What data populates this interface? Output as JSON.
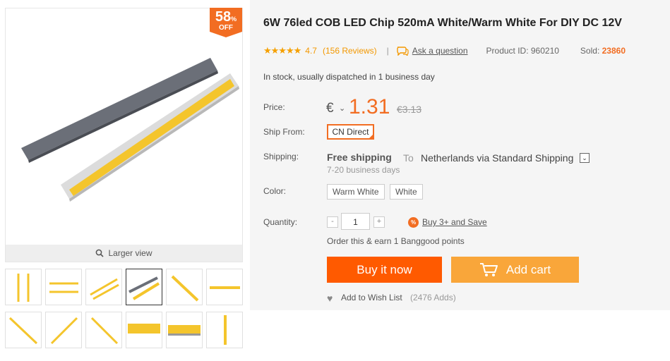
{
  "product": {
    "title": "6W 76led COB LED Chip 520mA White/Warm White For DIY DC 12V",
    "rating": "4.7",
    "reviews": "(156 Reviews)",
    "ask": "Ask a question",
    "product_id": "Product ID: 960210",
    "sold_label": "Sold:",
    "sold_value": "23860",
    "stock": "In stock, usually dispatched in 1 business day"
  },
  "gallery": {
    "discount_pct": "58",
    "discount_sign": "%",
    "discount_off": "OFF",
    "larger_view": "Larger view",
    "thumb_count": 12,
    "active_thumb": 4
  },
  "price": {
    "label": "Price:",
    "currency": "€",
    "current": "1.31",
    "old": "€3.13"
  },
  "ship_from": {
    "label": "Ship From:",
    "value": "CN Direct"
  },
  "shipping": {
    "label": "Shipping:",
    "free": "Free shipping",
    "to": "To",
    "destination": "Netherlands via Standard Shipping",
    "days": "7-20 business days"
  },
  "color": {
    "label": "Color:",
    "options": [
      "Warm White",
      "White"
    ]
  },
  "quantity": {
    "label": "Quantity:",
    "minus": "-",
    "value": "1",
    "plus": "+",
    "deal_icon": "%",
    "deal": "Buy 3+ and Save"
  },
  "points": "Order this & earn 1 Banggood points",
  "actions": {
    "buy_now": "Buy it now",
    "add_cart": "Add cart"
  },
  "wishlist": {
    "label": "Add to Wish List",
    "count": "(2476 Adds)"
  },
  "colors": {
    "accent": "#f26d22",
    "buy_now_bg": "#ff5a00",
    "add_cart_bg": "#f9a63a",
    "star": "#f5a000",
    "panel_bg": "#f5f5f5"
  }
}
